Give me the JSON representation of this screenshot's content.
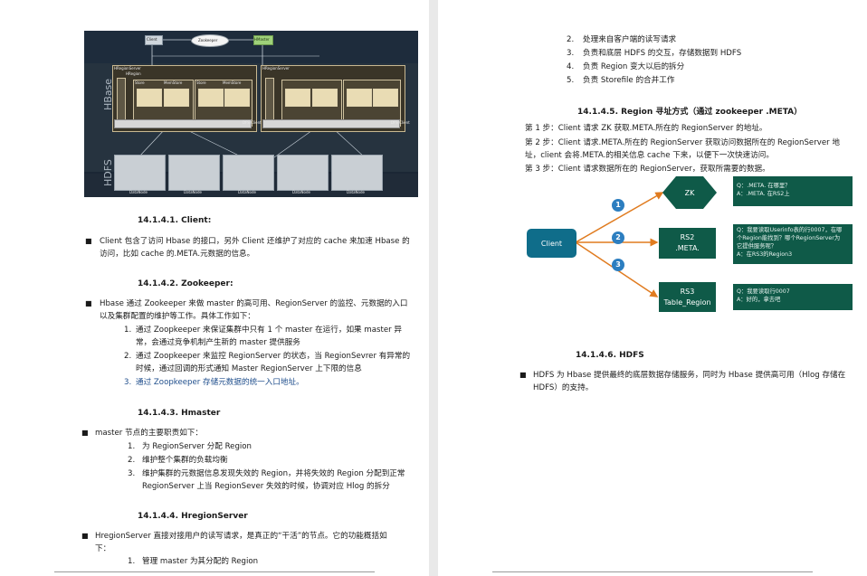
{
  "left": {
    "diagram": {
      "client": "Client",
      "zookeeper": "Zookeeper",
      "hmaster": "HMaster",
      "hbase_label": "HBase",
      "hdfs_label": "HDFS",
      "rs1": "HRegionServer",
      "rs2": "HRegionServer",
      "hregion": "HRegion",
      "hlog": "HLog",
      "store": "Store",
      "memstore": "MemStore",
      "storefile": "StoreFile",
      "hfile": "HFile",
      "dfs_client": "DFS Client",
      "datanode": "DataNode"
    },
    "s1_title": "14.1.4.1.  Client:",
    "s1_b1_l1": "Client 包含了访问 Hbase 的接口，另外 Client 还维护了对应的 cache 来加速 Hbase 的",
    "s1_b1_l2": "访问，比如 cache 的.META.元数据的信息。",
    "s2_title": "14.1.4.2.  Zookeeper:",
    "s2_b1_l1": "Hbase 通过 Zookeeper 来做 master 的高可用、RegionServer 的监控、元数据的入口",
    "s2_b1_l2": "以及集群配置的维护等工作。具体工作如下：",
    "s2_n1_l1": "通过 Zoopkeeper 来保证集群中只有 1 个 master 在运行，如果 master 异",
    "s2_n1_l2": "常，会通过竞争机制产生新的 master 提供服务",
    "s2_n2_l1": "通过 Zoopkeeper 来监控 RegionServer 的状态，当 RegionSevrer 有异常的",
    "s2_n2_l2": "时候，通过回调的形式通知 Master RegionServer 上下限的信息",
    "s2_n3": "通过 Zoopkeeper 存储元数据的统一入口地址。",
    "s3_title": "14.1.4.3.  Hmaster",
    "s3_b1": "master 节点的主要职责如下：",
    "s3_n1": "为 RegionServer 分配 Region",
    "s3_n2": "维护整个集群的负载均衡",
    "s3_n3_l1": "维护集群的元数据信息发现失效的 Region，并将失效的 Region 分配到正常",
    "s3_n3_l2": "RegionServer 上当 RegionSever 失效的时候，协调对应 Hlog 的拆分",
    "s4_title": "14.1.4.4.  HregionServer",
    "s4_b1_l1": "HregionServer 直接对接用户的读写请求，是真正的“干活”的节点。它的功能概括如",
    "s4_b1_l2": "下：",
    "s4_n1": "管理 master 为其分配的 Region"
  },
  "right": {
    "n2": "处理来自客户端的读写请求",
    "n3": "负责和底层 HDFS 的交互，存储数据到 HDFS",
    "n4": "负责 Region 变大以后的拆分",
    "n5": "负责 Storefile 的合并工作",
    "s5_title": "14.1.4.5.  Region 寻址方式（通过 zookeeper .META）",
    "step1": "第 1 步：Client 请求 ZK 获取.META.所在的 RegionServer 的地址。",
    "step2_l1": "第 2 步：Client 请求.META.所在的 RegionServer 获取访问数据所在的 RegionServer 地",
    "step2_l2": "址，client 会将.META.的相关信息 cache 下来，以便下一次快速访问。",
    "step3": "第 3 步：Client 请求数据所在的 RegionServer，获取所需要的数据。",
    "route": {
      "client": "Client",
      "zk": "ZK",
      "rs2_l1": "RS2",
      "rs2_l2": ".META.",
      "rs3_l1": "RS3",
      "rs3_l2": "Table_Region",
      "num1": "1",
      "num2": "2",
      "num3": "3",
      "note1_l1": "Q：.META. 在哪里？",
      "note1_l2": "A：.META. 在RS2上",
      "note2_l1": "Q：我要读取Userinfo表的行0007，在哪",
      "note2_l2": "个Region能找到？哪个RegionServer为",
      "note2_l3": "它提供服务呢？",
      "note2_l4": "A：在RS3的Region3",
      "note3_l1": "Q：我要读取行0007",
      "note3_l2": "A：好的，拿去吧"
    },
    "s6_title": "14.1.4.6.  HDFS",
    "s6_b1_l1": "HDFS 为 Hbase 提供最终的底层数据存储服务，同时为 Hbase 提供高可用（Hlog 存储在",
    "s6_b1_l2": "HDFS）的支持。"
  }
}
